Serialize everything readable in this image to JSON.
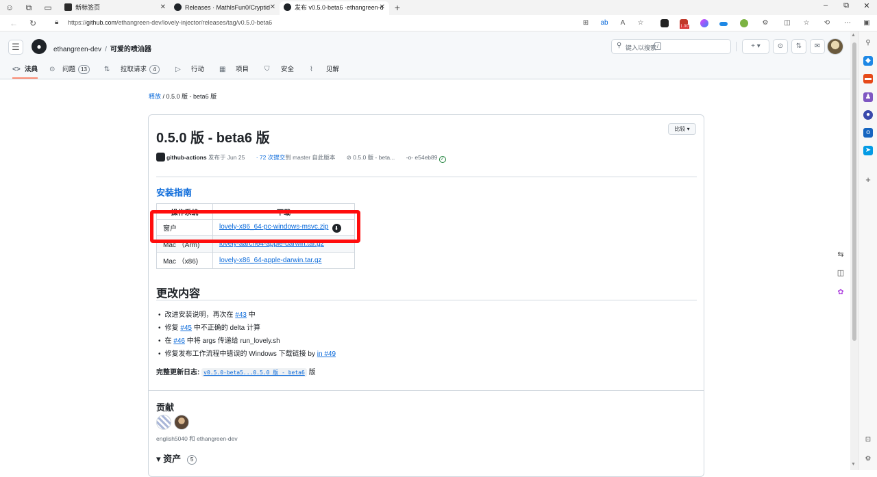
{
  "browser": {
    "tabs": [
      {
        "title": "新标签页",
        "active": false
      },
      {
        "title": "Releases · MathIsFun0/Cryptid",
        "active": false
      },
      {
        "title": "发布 v0.5.0-beta6 ·ethangreen-d",
        "active": true
      }
    ],
    "new_tab": "+",
    "url_prefix": "https://",
    "url_host": "github.com",
    "url_path": "/ethangreen-dev/lovely-injector/releases/tag/v0.5.0-beta6",
    "ext_badge": "1.00"
  },
  "header": {
    "owner": "ethangreen-dev",
    "sep": "/",
    "repo": "可爱的喷油器",
    "search_placeholder": "键入以搜索",
    "search_key": "/",
    "plus_label": "+ ▾"
  },
  "repo_nav": [
    {
      "icon": "<>",
      "label": "法典",
      "count": ""
    },
    {
      "icon": "⊙",
      "label": "问题",
      "count": "13"
    },
    {
      "icon": "⇅",
      "label": "拉取请求",
      "count": "4"
    },
    {
      "icon": "▷",
      "label": "行动",
      "count": ""
    },
    {
      "icon": "▦",
      "label": "项目",
      "count": ""
    },
    {
      "icon": "⛉",
      "label": "安全",
      "count": ""
    },
    {
      "icon": "⌇",
      "label": "见解",
      "count": ""
    }
  ],
  "breadcrumb": {
    "link": "释放",
    "sep": " / ",
    "current": "0.5.0 版 - beta6 版"
  },
  "release": {
    "title": "0.5.0 版 - beta6 版",
    "compare": "比较 ▾",
    "author": "github-actions",
    "published": "发布于 Jun 25",
    "commits_link": "· 72 次提交",
    "commits_rest": "到 master 自此版本",
    "tag": "0.5.0 版 - beta...",
    "commit": "e54eb89"
  },
  "install": {
    "heading": "安装指南",
    "headers": [
      "操作系统",
      "下载"
    ],
    "rows": [
      {
        "os": "窗户",
        "file": "lovely-x86_64-pc-windows-msvc.zip"
      },
      {
        "os": "Mac （Arm)",
        "file": "lovely-aarch64-apple-darwin.tar.gz"
      },
      {
        "os": "Mac （x86)",
        "file": "lovely-x86_64-apple-darwin.tar.gz"
      }
    ]
  },
  "changes": {
    "heading": "更改内容",
    "items": [
      {
        "pre": "改进安装说明，再次在 ",
        "link": "#43",
        "post": " 中"
      },
      {
        "pre": "修复 ",
        "link": "#45",
        "post": " 中不正确的 delta 计算"
      },
      {
        "pre": "在 ",
        "link": "#46",
        "post": " 中将 args 传递给 run_lovely.sh"
      },
      {
        "pre": "修复发布工作流程中错误的 Windows 下载链接 by ",
        "link": "in #49",
        "post": ""
      }
    ],
    "full_label": "完整更新日志:",
    "full_link": "v0.5.0-beta5...0.5.0 版 - beta6",
    "full_post": "版"
  },
  "contributors": {
    "heading": "贡献",
    "names": "english5040 和 ethangreen-dev"
  },
  "assets": {
    "heading": "▾ 资产",
    "count": "5"
  },
  "colors": {
    "accent": "#0969da",
    "highlight": "#ff0d0d",
    "tab_underline": "#fd8c73"
  }
}
